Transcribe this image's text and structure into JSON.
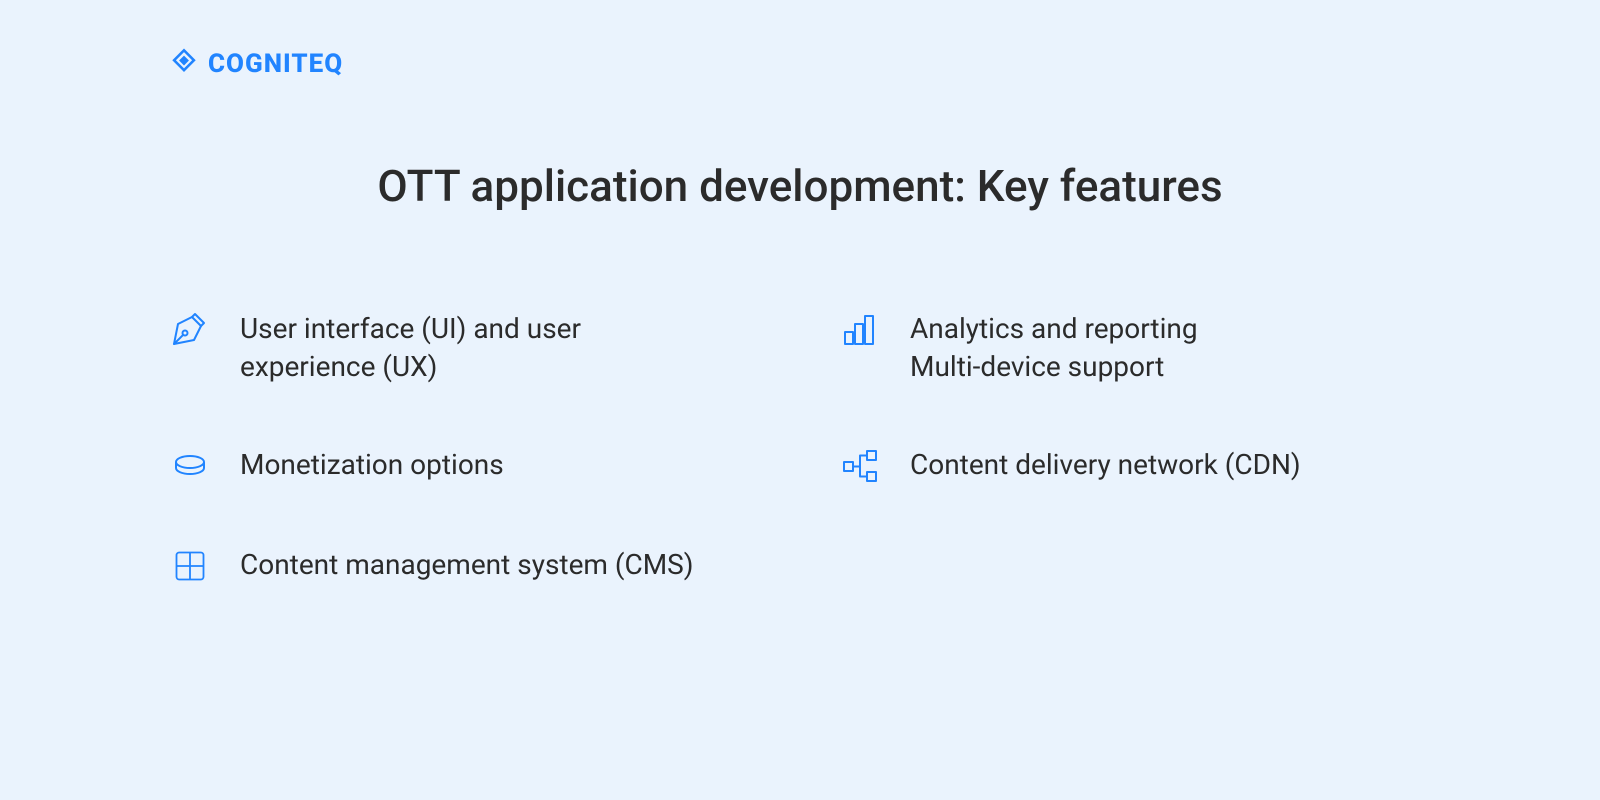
{
  "brand": {
    "name": "COGNITEQ"
  },
  "title": "OTT application development: Key features",
  "features": {
    "ui_ux": "User interface (UI) and user experience (UX)",
    "analytics": "Analytics and reporting\nMulti-device support",
    "monetization": "Monetization options",
    "cdn": "Content delivery network (CDN)",
    "cms": "Content management system (CMS)"
  },
  "colors": {
    "accent": "#2184FF",
    "background": "#EAF3FD",
    "text": "#2B2B2B"
  }
}
